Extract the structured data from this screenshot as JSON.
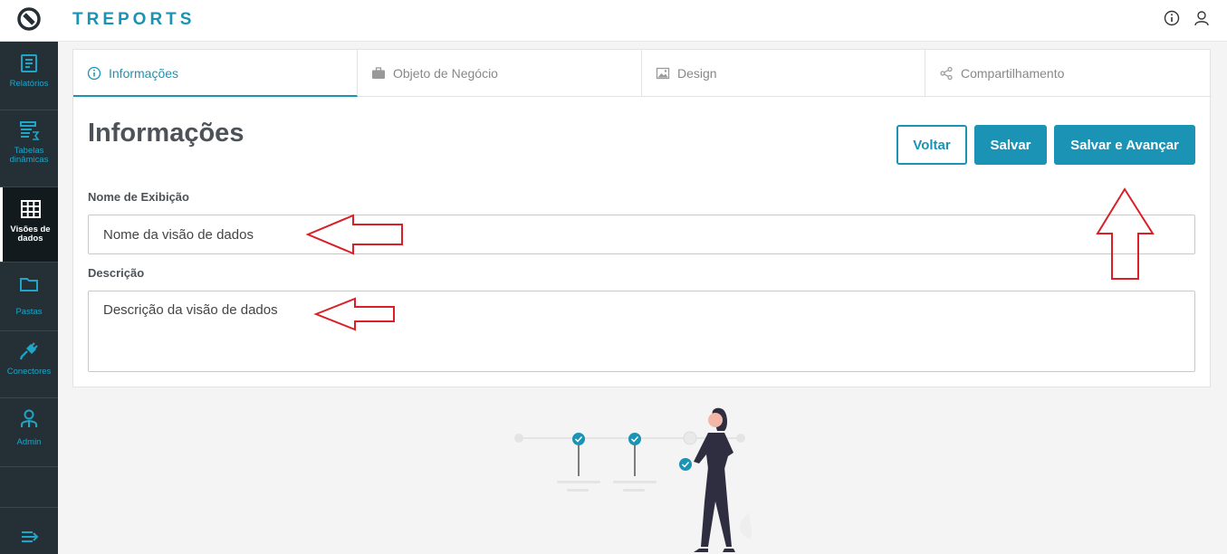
{
  "app": {
    "brand": "TREPORTS"
  },
  "header": {
    "icons": [
      "info-icon",
      "user-icon"
    ]
  },
  "sidebar": {
    "items": [
      {
        "label": "Relatórios",
        "icon": "report-icon"
      },
      {
        "label": "Tabelas dinâmicas",
        "icon": "pivot-table-icon"
      },
      {
        "label": "Visões de dados",
        "icon": "grid-icon",
        "active": true
      },
      {
        "label": "Pastas",
        "icon": "folder-icon"
      },
      {
        "label": "Conectores",
        "icon": "plug-icon"
      },
      {
        "label": "Admin",
        "icon": "admin-icon"
      }
    ],
    "collapse_icon": "expand-menu-icon"
  },
  "tabs": [
    {
      "label": "Informações",
      "icon": "info-icon",
      "active": true
    },
    {
      "label": "Objeto de Negócio",
      "icon": "briefcase-icon"
    },
    {
      "label": "Design",
      "icon": "image-icon"
    },
    {
      "label": "Compartilhamento",
      "icon": "share-icon"
    }
  ],
  "page": {
    "title": "Informações"
  },
  "buttons": {
    "back": "Voltar",
    "save": "Salvar",
    "save_next": "Salvar e Avançar"
  },
  "form": {
    "name_label": "Nome de Exibição",
    "name_value": "Nome da visão de dados",
    "desc_label": "Descrição",
    "desc_value": "Descrição da visão de dados"
  },
  "colors": {
    "accent": "#1a93b4",
    "sidebar": "#253036",
    "annotation": "#d92027"
  }
}
